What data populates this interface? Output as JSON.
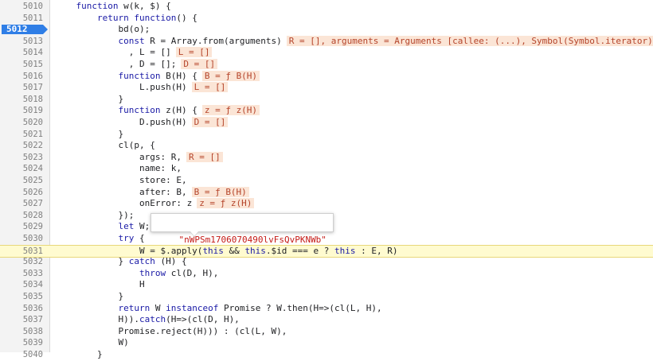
{
  "tooltip": {
    "value": "\"nWPSm1706070490lvFsQvPKNWb\""
  },
  "lines": [
    {
      "num": "5010",
      "code": "    function w(k, $) {"
    },
    {
      "num": "5011",
      "code": "        return function() {"
    },
    {
      "num": "5012",
      "code": "            bd(o);",
      "breakpoint": true
    },
    {
      "num": "5013",
      "code": "            const R = Array.from(arguments)",
      "inline": "R = [], arguments = Arguments [callee: (...), Symbol(Symbol.iterator)"
    },
    {
      "num": "5014",
      "code": "              , L = []",
      "inline": "L = []"
    },
    {
      "num": "5015",
      "code": "              , D = [];",
      "inline": "D = []"
    },
    {
      "num": "5016",
      "code": "            function B(H) {",
      "inline": "B = ƒ B(H)"
    },
    {
      "num": "5017",
      "code": "                L.push(H)",
      "inline": "L = []"
    },
    {
      "num": "5018",
      "code": "            }"
    },
    {
      "num": "5019",
      "code": "            function z(H) {",
      "inline": "z = ƒ z(H)"
    },
    {
      "num": "5020",
      "code": "                D.push(H)",
      "inline": "D = []"
    },
    {
      "num": "5021",
      "code": "            }"
    },
    {
      "num": "5022",
      "code": "            cl(p, {"
    },
    {
      "num": "5023",
      "code": "                args: R,",
      "inline": "R = []"
    },
    {
      "num": "5024",
      "code": "                name: k,"
    },
    {
      "num": "5025",
      "code": "                store: E,"
    },
    {
      "num": "5026",
      "code": "                after: B,",
      "inline": "B = ƒ B(H)"
    },
    {
      "num": "5027",
      "code": "                onError: z",
      "inline": "z = ƒ z(H)"
    },
    {
      "num": "5028",
      "code": "            });"
    },
    {
      "num": "5029",
      "code": "            let W;"
    },
    {
      "num": "5030",
      "code": "            try {"
    },
    {
      "num": "5031",
      "code": "                W = $.apply(this && this.$id === e ? this : E, R)",
      "current": true
    },
    {
      "num": "5032",
      "code": "            } catch (H) {"
    },
    {
      "num": "5033",
      "code": "                throw cl(D, H),"
    },
    {
      "num": "5034",
      "code": "                H"
    },
    {
      "num": "5035",
      "code": "            }"
    },
    {
      "num": "5036",
      "code": "            return W instanceof Promise ? W.then(H=>(cl(L, H),"
    },
    {
      "num": "5037",
      "code": "            H)).catch(H=>(cl(D, H),"
    },
    {
      "num": "5038",
      "code": "            Promise.reject(H))) : (cl(L, W),"
    },
    {
      "num": "5039",
      "code": "            W)"
    },
    {
      "num": "5040",
      "code": "        }"
    }
  ]
}
